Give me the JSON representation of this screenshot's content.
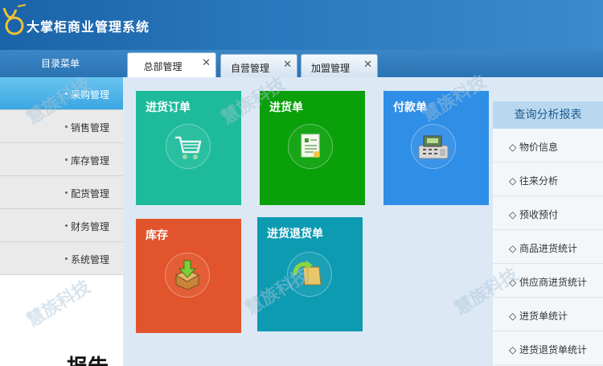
{
  "app": {
    "title": "大掌柜商业管理系统"
  },
  "sidebar": {
    "caption": "目录菜单",
    "items": [
      {
        "label": "采购管理",
        "active": true
      },
      {
        "label": "销售管理"
      },
      {
        "label": "库存管理"
      },
      {
        "label": "配货管理"
      },
      {
        "label": "财务管理"
      },
      {
        "label": "系统管理"
      }
    ],
    "bottom_text": "— 报告"
  },
  "tabs": [
    {
      "label": "总部管理",
      "close": "✕",
      "active": true
    },
    {
      "label": "自营管理",
      "close": "✕"
    },
    {
      "label": "加盟管理",
      "close": "✕"
    }
  ],
  "tiles": [
    {
      "label": "进货订单",
      "color": "#1dbb9c",
      "icon": "shopping-cart-icon"
    },
    {
      "label": "进货单",
      "color": "#0aa00a",
      "icon": "document-icon"
    },
    {
      "label": "付款单",
      "color": "#2f8ee6",
      "icon": "cash-register-icon"
    },
    {
      "label": "库存",
      "color": "#e2542b",
      "icon": "inventory-box-icon"
    },
    {
      "label": "进货退货单",
      "color": "#0d9bb2",
      "icon": "return-goods-icon"
    }
  ],
  "report_panel": {
    "title": "查询分析报表",
    "items": [
      {
        "label": "◇ 物价信息"
      },
      {
        "label": "◇ 往来分析"
      },
      {
        "label": "◇ 预收预付"
      },
      {
        "label": "◇ 商品进货统计"
      },
      {
        "label": "◇ 供应商进货统计"
      },
      {
        "label": "◇ 进货单统计"
      },
      {
        "label": "◇ 进货退货单统计"
      }
    ]
  },
  "watermark": "慧族科技"
}
